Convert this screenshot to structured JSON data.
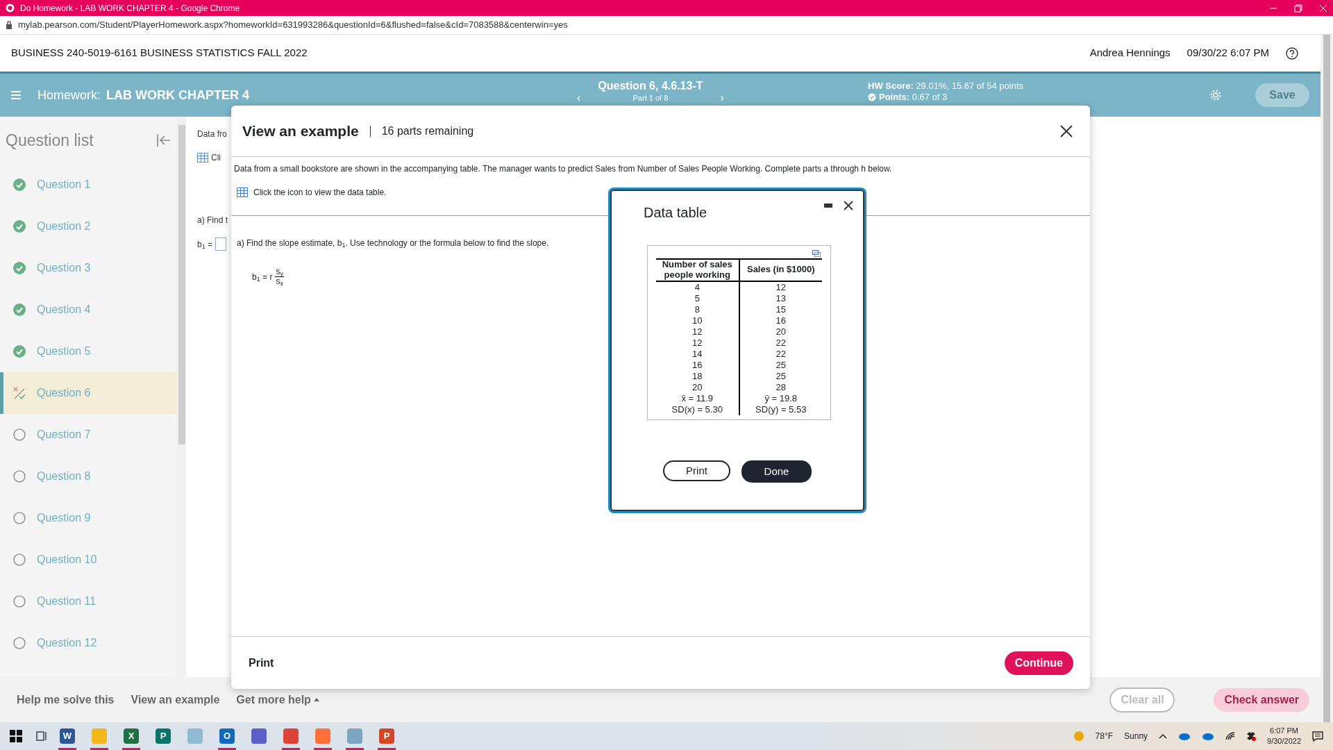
{
  "browser": {
    "title": "Do Homework - LAB WORK CHAPTER 4 - Google Chrome",
    "url": "mylab.pearson.com/Student/PlayerHomework.aspx?homeworkId=631993286&questionId=6&flushed=false&cId=7083588&centerwin=yes"
  },
  "course_header": {
    "title": "BUSINESS 240-5019-6161 BUSINESS STATISTICS FALL 2022",
    "user": "Andrea Hennings",
    "datetime": "09/30/22 6:07 PM"
  },
  "homework_bar": {
    "label": "Homework:",
    "name": "LAB WORK CHAPTER 4",
    "prev": "‹",
    "question": "Question 6, 4.6.13-T",
    "part": "Part 1 of 8",
    "next": "›",
    "score_label": "HW Score:",
    "score": "29.01%, 15.67 of 54 points",
    "points_label": "Points:",
    "points": "0.67 of 3",
    "save": {
      "label": "Save",
      "disabled": true
    }
  },
  "question_list": {
    "title": "Question list",
    "items": [
      {
        "label": "Question 1",
        "kind": "correct",
        "selected": false
      },
      {
        "label": "Question 2",
        "kind": "correct",
        "selected": false
      },
      {
        "label": "Question 3",
        "kind": "correct",
        "selected": false
      },
      {
        "label": "Question 4",
        "kind": "correct",
        "selected": false
      },
      {
        "label": "Question 5",
        "kind": "correct",
        "selected": false
      },
      {
        "label": "Question 6",
        "kind": "partial",
        "selected": true
      },
      {
        "label": "Question 7",
        "kind": "unanswered",
        "selected": false
      },
      {
        "label": "Question 8",
        "kind": "unanswered",
        "selected": false
      },
      {
        "label": "Question 9",
        "kind": "unanswered",
        "selected": false
      },
      {
        "label": "Question 10",
        "kind": "unanswered",
        "selected": false
      },
      {
        "label": "Question 11",
        "kind": "unanswered",
        "selected": false
      },
      {
        "label": "Question 12",
        "kind": "unanswered",
        "selected": false
      }
    ]
  },
  "background_question": {
    "intro": "Data fro",
    "table_link": "Cli",
    "part_a": "a) Find t",
    "answer_label": "b$_{1}$ ="
  },
  "example_dialog": {
    "title": "View an example",
    "remaining": "16 parts remaining",
    "intro": "Data from a small bookstore are shown in the accompanying table. The manager wants to predict Sales from Number of Sales People Working. Complete parts a through h below.",
    "table_link": "Click the icon to view the data table.",
    "part_a": "a) Find the slope estimate, b$_{1}$. Use technology or the formula below to find the slope.",
    "formula": {
      "lhs": "b$_{1}$ = r",
      "numerator": "s$_{y}$",
      "denominator": "s$_{x}$"
    },
    "print": "Print",
    "continue": "Continue"
  },
  "data_table_dialog": {
    "title": "Data table",
    "columns": [
      "Number of sales people working",
      "Sales (in $1000)"
    ],
    "rows": [
      [
        "4",
        "12"
      ],
      [
        "5",
        "13"
      ],
      [
        "8",
        "15"
      ],
      [
        "10",
        "16"
      ],
      [
        "12",
        "20"
      ],
      [
        "12",
        "22"
      ],
      [
        "14",
        "22"
      ],
      [
        "16",
        "25"
      ],
      [
        "18",
        "25"
      ],
      [
        "20",
        "28"
      ]
    ],
    "stats": [
      [
        "x̄ = 11.9",
        "ȳ = 19.8"
      ],
      [
        "SD(x) = 5.30",
        "SD(y) = 5.53"
      ]
    ],
    "buttons": [
      {
        "label": "Print",
        "kind": "outline"
      },
      {
        "label": "Done",
        "kind": "solid"
      }
    ]
  },
  "bottom_bar": {
    "links": [
      {
        "label": "Help me solve this",
        "menu": false
      },
      {
        "label": "View an example",
        "menu": false
      },
      {
        "label": "Get more help",
        "menu": true
      }
    ],
    "clear": {
      "label": "Clear all",
      "disabled": false
    },
    "check": {
      "label": "Check answer",
      "disabled": true
    }
  },
  "taskbar": {
    "apps": [
      {
        "color": "#2b5797",
        "letter": "W",
        "active": true
      },
      {
        "color": "#f2b81c",
        "active": true
      },
      {
        "color": "#1e7145",
        "letter": "X",
        "active": true
      },
      {
        "color": "#077568",
        "letter": "P",
        "active": false
      },
      {
        "color": "#8fbcd4",
        "active": false
      },
      {
        "color": "#0f6cbd",
        "letter": "O",
        "active": true
      },
      {
        "color": "#5b5fc7",
        "active": false
      },
      {
        "color": "#db4437",
        "active": true
      },
      {
        "color": "#ff7139",
        "active": true
      },
      {
        "color": "#7aa6c2",
        "active": true
      },
      {
        "color": "#d24726",
        "letter": "P",
        "active": true
      }
    ],
    "temperature": "78°F",
    "weather": "Sunny",
    "time": "6:07 PM",
    "date": "9/30/2022"
  }
}
